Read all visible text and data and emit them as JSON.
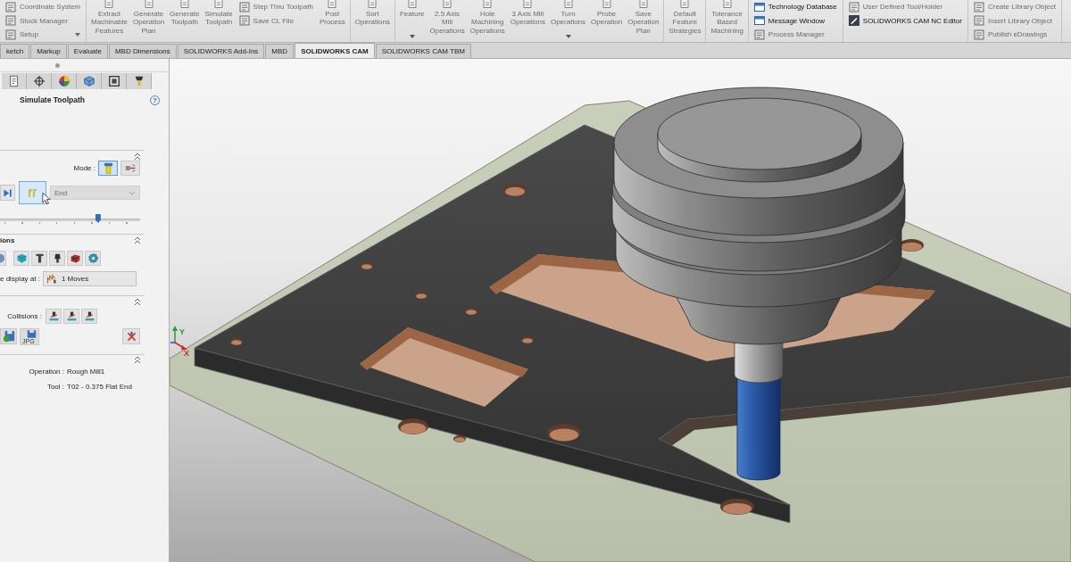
{
  "ribbon": {
    "groups": [
      {
        "items": [
          {
            "kind": "stack",
            "rows": [
              {
                "label": "Coordinate System",
                "disabled": true
              },
              {
                "label": "Stock Manager",
                "disabled": true
              },
              {
                "label": "Setup",
                "disabled": true,
                "dropdown": true
              }
            ]
          }
        ]
      },
      {
        "items": [
          {
            "kind": "large",
            "lines": [
              "Extract",
              "Machinable",
              "Features"
            ],
            "disabled": true
          },
          {
            "kind": "large",
            "lines": [
              "Generate",
              "Operation",
              "Plan"
            ],
            "disabled": true
          },
          {
            "kind": "large",
            "lines": [
              "Generate",
              "Toolpath"
            ],
            "disabled": true
          },
          {
            "kind": "large",
            "lines": [
              "Simulate",
              "Toolpath"
            ],
            "disabled": true
          },
          {
            "kind": "stack",
            "rows": [
              {
                "label": "Step Thru Toolpath",
                "disabled": true
              },
              {
                "label": "Save CL File",
                "disabled": true
              }
            ]
          },
          {
            "kind": "large",
            "lines": [
              "Post",
              "Process"
            ],
            "disabled": true
          }
        ]
      },
      {
        "items": [
          {
            "kind": "large",
            "lines": [
              "Sort",
              "Operations"
            ],
            "disabled": true
          }
        ]
      },
      {
        "items": [
          {
            "kind": "large",
            "lines": [
              "Feature"
            ],
            "disabled": true,
            "dropdown": true
          },
          {
            "kind": "large",
            "lines": [
              "2.5 Axis",
              "Mill",
              "Operations"
            ],
            "disabled": true
          },
          {
            "kind": "large",
            "lines": [
              "Hole",
              "Machining",
              "Operations"
            ],
            "disabled": true
          },
          {
            "kind": "large",
            "lines": [
              "3 Axis Mill",
              "Operations"
            ],
            "disabled": true
          },
          {
            "kind": "large",
            "lines": [
              "Turn",
              "Operations"
            ],
            "disabled": true,
            "dropdown": true
          },
          {
            "kind": "large",
            "lines": [
              "Probe",
              "Operation"
            ],
            "disabled": true
          },
          {
            "kind": "large",
            "lines": [
              "Save",
              "Operation",
              "Plan"
            ],
            "disabled": true
          }
        ]
      },
      {
        "items": [
          {
            "kind": "large",
            "lines": [
              "Default",
              "Feature",
              "Strategies"
            ],
            "disabled": true
          }
        ]
      },
      {
        "items": [
          {
            "kind": "large",
            "lines": [
              "Tolerance",
              "Based",
              "Machining"
            ],
            "disabled": true
          }
        ]
      },
      {
        "items": [
          {
            "kind": "stack",
            "rows": [
              {
                "label": "Technology Database",
                "disabled": false
              },
              {
                "label": "Message Window",
                "disabled": false
              },
              {
                "label": "Process Manager",
                "disabled": true
              }
            ]
          }
        ]
      },
      {
        "items": [
          {
            "kind": "stack",
            "rows": [
              {
                "label": "User Defined Tool/Holder",
                "disabled": true
              },
              {
                "label": "SOLIDWORKS CAM NC Editor",
                "disabled": false
              }
            ]
          }
        ]
      },
      {
        "items": [
          {
            "kind": "stack",
            "rows": [
              {
                "label": "Create Library Object",
                "disabled": true
              },
              {
                "label": "Insert Library Object",
                "disabled": true
              },
              {
                "label": "Publish eDrawings",
                "disabled": true
              }
            ]
          }
        ]
      }
    ]
  },
  "tabs": [
    {
      "label": "ketch",
      "selected": false
    },
    {
      "label": "Markup",
      "selected": false
    },
    {
      "label": "Evaluate",
      "selected": false
    },
    {
      "label": "MBD Dimensions",
      "selected": false
    },
    {
      "label": "SOLIDWORKS Add-Ins",
      "selected": false
    },
    {
      "label": "MBD",
      "selected": false
    },
    {
      "label": "SOLIDWORKS CAM",
      "selected": true
    },
    {
      "label": "SOLIDWORKS CAM TBM",
      "selected": false
    }
  ],
  "panel": {
    "title": "Simulate Toolpath",
    "help": "?",
    "sections": [
      {
        "kind": "playback",
        "expanded": true,
        "mode_label": "Mode :",
        "modes": [
          {
            "selected": true
          },
          {
            "selected": false
          }
        ],
        "controls": [
          {
            "selected": false
          },
          {
            "selected": true
          }
        ],
        "dropdown": {
          "value": "End",
          "disabled": true
        },
        "slider": {
          "level": 0.7
        }
      },
      {
        "kind": "display",
        "expanded": true,
        "heading": "ions",
        "display_label": "e display at :",
        "display_value": "1 Moves"
      },
      {
        "kind": "collisions",
        "expanded": true,
        "label": "Collisions :",
        "image_format": "JPG"
      },
      {
        "kind": "info",
        "expanded": true,
        "fields": [
          {
            "label": "Operation :",
            "value": "Rough Mill1"
          },
          {
            "label": "Tool :",
            "value": "T02 - 0.375 Flat End"
          }
        ]
      }
    ]
  },
  "viewport": {
    "triad": {
      "y_label": "Y",
      "x_label": "X"
    }
  }
}
